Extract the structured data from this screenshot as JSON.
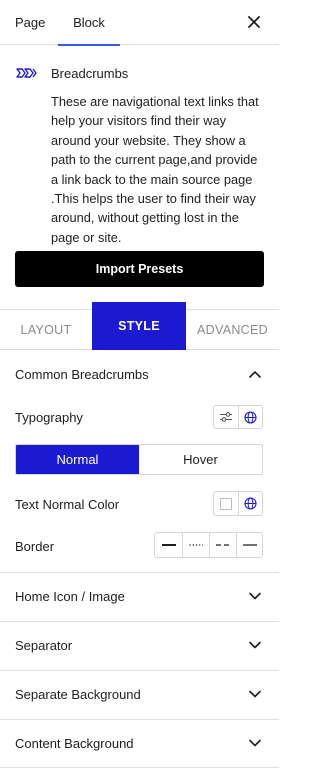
{
  "top_tabs": {
    "page": "Page",
    "block": "Block"
  },
  "block": {
    "title": "Breadcrumbs",
    "description": "These are navigational text links that help your visitors find their way around your website. They show a path to the current page,and provide a link back to the main source page .This helps the user to find their way around, without getting lost in the page or site.",
    "import_button": "Import Presets"
  },
  "mode_tabs": {
    "layout": "LAYOUT",
    "style": "STYLE",
    "advanced": "ADVANCED"
  },
  "common": {
    "title": "Common Breadcrumbs",
    "typography_label": "Typography",
    "states": {
      "normal": "Normal",
      "hover": "Hover"
    },
    "text_color_label": "Text Normal Color",
    "border_label": "Border"
  },
  "panels": [
    {
      "label": "Home Icon / Image"
    },
    {
      "label": "Separator"
    },
    {
      "label": "Separate Background"
    },
    {
      "label": "Content Background"
    }
  ],
  "colors": {
    "accent": "#1c1ad1",
    "tab_underline": "#3858e9",
    "import_bg": "#000000"
  }
}
